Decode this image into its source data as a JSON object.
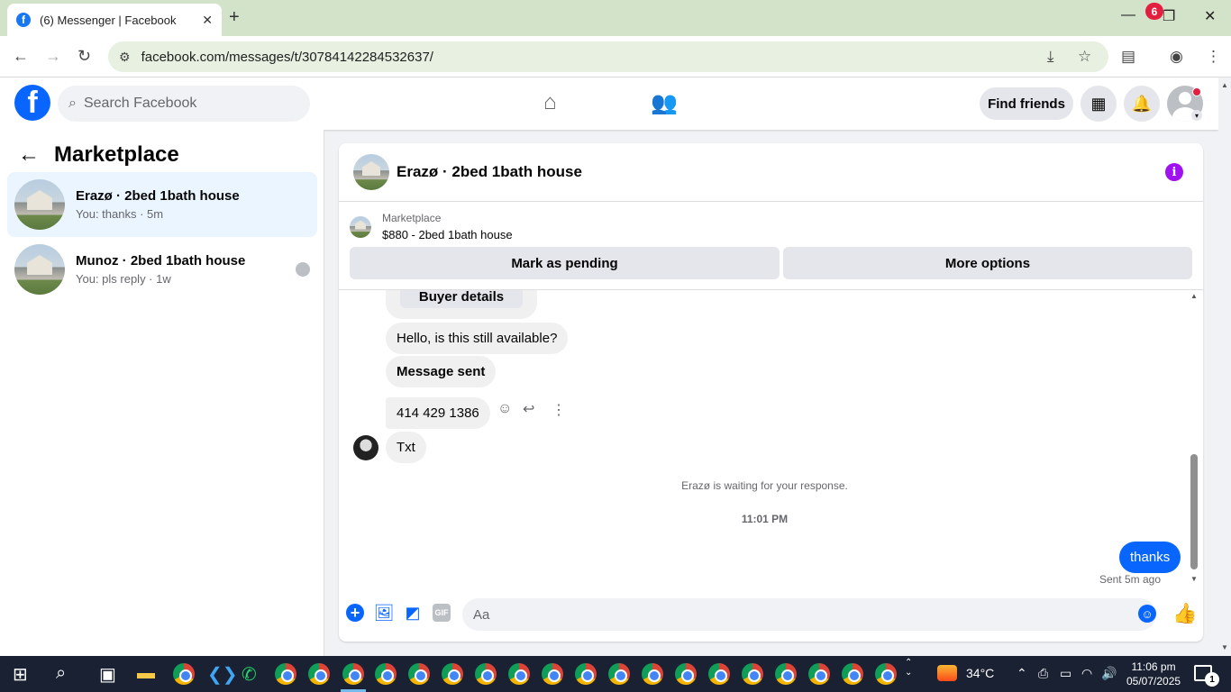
{
  "browser": {
    "tab_title": "(6) Messenger | Facebook",
    "url": "facebook.com/messages/t/30784142284532637/"
  },
  "fb_header": {
    "search_placeholder": "Search Facebook",
    "find_friends": "Find friends",
    "notification_count": "6"
  },
  "sidebar": {
    "title": "Marketplace",
    "conversations": [
      {
        "name": "Erazø · 2bed 1bath house",
        "preview": "You: thanks · 5m",
        "active": true
      },
      {
        "name": "Munoz · 2bed 1bath house",
        "preview": "You: pls reply · 1w",
        "active": false
      }
    ]
  },
  "chat": {
    "title": "Erazø · 2bed 1bath house",
    "listing": {
      "label": "Marketplace",
      "price": "$880 - 2bed 1bath house"
    },
    "actions": {
      "mark_pending": "Mark as pending",
      "more_options": "More options"
    },
    "messages": {
      "buyer_details": "Buyer details",
      "m1": "Hello, is this still available?",
      "m2": "Message sent",
      "m3": "414 429 1386",
      "m4": "Txt",
      "waiting": "Erazø is waiting for your response.",
      "timestamp": "11:01 PM",
      "mine": "thanks",
      "sent": "Sent 5m ago"
    },
    "composer": {
      "placeholder": "Aa",
      "gif": "GIF"
    }
  },
  "taskbar": {
    "temperature": "34°C",
    "time": "11:06 pm",
    "date": "05/07/2025",
    "notifications": "1"
  },
  "colors": {
    "fb_blue": "#0866ff",
    "active_conv": "#ebf5ff",
    "info_purple": "#a011f0"
  }
}
